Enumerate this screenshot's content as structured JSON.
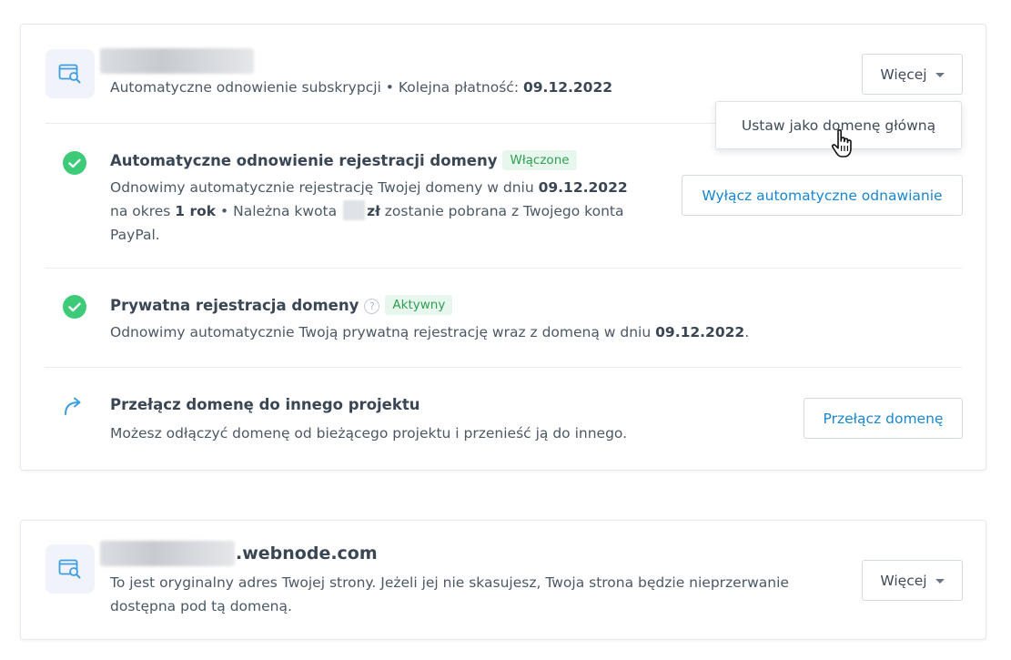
{
  "domain_card": {
    "subtitle_prefix": "Automatyczne odnowienie subskrypcji • Kolejna płatność:",
    "subtitle_date": "09.12.2022",
    "more_button": "Więcej",
    "dropdown_item": "Ustaw jako domenę główną",
    "rows": [
      {
        "title": "Automatyczne odnowienie rejestracji domeny",
        "badge": "Włączone",
        "text_1": "Odnowimy automatycznie rejestrację Twojej domeny w dniu",
        "date": "09.12.2022",
        "text_2": "na okres",
        "period": "1 rok",
        "text_3": "• Należna kwota",
        "currency": "zł",
        "text_4": "zostanie pobrana z Twojego konta",
        "text_5": "PayPal.",
        "button": "Wyłącz automatyczne odnawianie"
      },
      {
        "title": "Prywatna rejestracja domeny",
        "help": "?",
        "badge": "Aktywny",
        "text_1": "Odnowimy automatycznie Twoją prywatną rejestrację wraz z domeną w dniu",
        "date": "09.12.2022",
        "text_end": "."
      },
      {
        "title": "Przełącz domenę do innego projektu",
        "text_1": "Możesz odłączyć domenę od bieżącego projektu i przenieść ją do innego.",
        "button": "Przełącz domenę"
      }
    ]
  },
  "webnode_card": {
    "domain_suffix": ".webnode.com",
    "text_1": "To jest oryginalny adres Twojej strony. Jeżeli jej nie skasujesz, Twoja strona będzie nieprzerwanie",
    "text_2": "dostępna pod tą domeną.",
    "more_button": "Więcej"
  },
  "icons": {
    "domain": "browser-search-icon",
    "check": "check-circle-icon",
    "switch": "arrow-redirect-icon",
    "caret": "caret-down-icon",
    "cursor": "hand-pointer-icon"
  },
  "colors": {
    "accent_blue": "#1a86cf",
    "success_green": "#3ecb79",
    "badge_green": "#2e9e52",
    "icon_bg": "#f1f3fb"
  }
}
